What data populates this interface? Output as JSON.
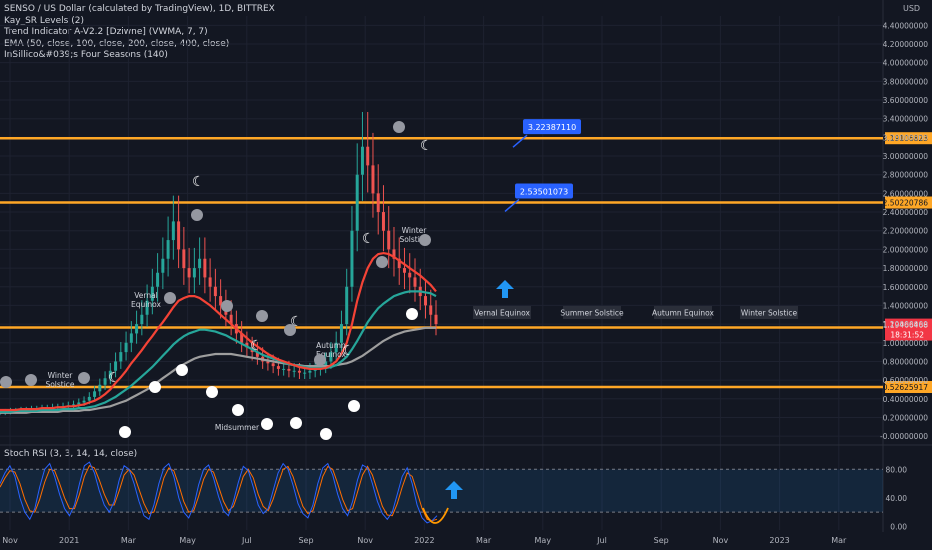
{
  "chart_data": {
    "type": "line",
    "title": "SENSO / US Dollar (calculated by TradingView), 1D, BITTREX",
    "indicators": [
      "Kay_SR Levels (2)",
      "Trend Indicator A-V2.2 [Dziwne] (VWMA, 7, 7)",
      "EMA (50, close, 100, close, 200, close, 400, close)",
      "InSillico&#039;s Four Seasons (140)"
    ],
    "currency": "USD",
    "y_ticks": [
      "4.40000000",
      "4.20000000",
      "4.00000000",
      "3.80000000",
      "3.60000000",
      "3.40000000",
      "3.20000000",
      "3.00000000",
      "2.80000000",
      "2.60000000",
      "2.40000000",
      "2.20000000",
      "2.00000000",
      "1.80000000",
      "1.60000000",
      "1.40000000",
      "1.20000000",
      "1.00000000",
      "0.80000000",
      "0.60000000",
      "0.40000000",
      "0.20000000",
      "-0.00000000"
    ],
    "ylim": [
      -0.02,
      4.5
    ],
    "x_labels": [
      "Nov",
      "2021",
      "Mar",
      "May",
      "Jul",
      "Sep",
      "Nov",
      "2022",
      "Mar",
      "May",
      "Jul",
      "Sep",
      "Nov",
      "2023",
      "Mar"
    ],
    "sr_levels": [
      {
        "value": 3.19106823,
        "label": "3.19106823"
      },
      {
        "value": 2.50220786,
        "label": "2.50220786"
      },
      {
        "value": 1.16385056,
        "label": "1.16385056"
      },
      {
        "value": 0.52625917,
        "label": "0.52625917"
      }
    ],
    "current_price": {
      "value": 1.19466468,
      "label": "1.19466468",
      "countdown": "18:31:52"
    },
    "callouts": [
      {
        "label": "3.22387110",
        "value": 3.2238711
      },
      {
        "label": "2.53501073",
        "value": 2.53501073
      }
    ],
    "season_labels_projected": [
      "Vernal Equinox",
      "Summer Solstice",
      "Autumn Equinox",
      "Winter Solstice"
    ],
    "season_labels_history": [
      "Vernal Equinox",
      "Winter Solstice",
      "Midsummer",
      "Autumn Equinox",
      "Winter Solstice"
    ],
    "price": [
      0.25,
      0.26,
      0.27,
      0.27,
      0.28,
      0.28,
      0.29,
      0.29,
      0.3,
      0.3,
      0.31,
      0.31,
      0.32,
      0.33,
      0.34,
      0.36,
      0.38,
      0.42,
      0.48,
      0.55,
      0.62,
      0.7,
      0.8,
      0.9,
      1.0,
      1.1,
      1.2,
      1.3,
      1.45,
      1.6,
      1.75,
      1.9,
      2.1,
      2.3,
      2.0,
      1.8,
      1.7,
      1.8,
      1.9,
      1.7,
      1.6,
      1.5,
      1.4,
      1.3,
      1.2,
      1.1,
      1.0,
      0.95,
      0.9,
      0.85,
      0.8,
      0.78,
      0.75,
      0.72,
      0.72,
      0.7,
      0.7,
      0.68,
      0.68,
      0.7,
      0.72,
      0.75,
      0.8,
      0.9,
      1.0,
      1.2,
      1.6,
      2.2,
      2.8,
      3.1,
      2.9,
      2.6,
      2.4,
      2.2,
      2.0,
      1.9,
      1.8,
      1.75,
      1.7,
      1.6,
      1.5,
      1.4,
      1.3,
      1.2
    ],
    "ema_fast": [
      0.28,
      0.28,
      0.28,
      0.28,
      0.29,
      0.29,
      0.29,
      0.29,
      0.3,
      0.3,
      0.3,
      0.31,
      0.31,
      0.32,
      0.32,
      0.33,
      0.34,
      0.36,
      0.38,
      0.41,
      0.45,
      0.5,
      0.57,
      0.63,
      0.7,
      0.78,
      0.85,
      0.92,
      1.0,
      1.07,
      1.15,
      1.22,
      1.3,
      1.38,
      1.45,
      1.48,
      1.5,
      1.5,
      1.48,
      1.44,
      1.4,
      1.35,
      1.3,
      1.25,
      1.2,
      1.15,
      1.1,
      1.05,
      1.0,
      0.96,
      0.92,
      0.88,
      0.85,
      0.82,
      0.8,
      0.78,
      0.76,
      0.74,
      0.73,
      0.72,
      0.72,
      0.72,
      0.73,
      0.76,
      0.8,
      0.88,
      1.0,
      1.2,
      1.45,
      1.65,
      1.8,
      1.9,
      1.95,
      1.96,
      1.95,
      1.92,
      1.88,
      1.84,
      1.8,
      1.76,
      1.72,
      1.67,
      1.62,
      1.55
    ],
    "ema_mid": [
      0.26,
      0.26,
      0.26,
      0.27,
      0.27,
      0.27,
      0.27,
      0.27,
      0.28,
      0.28,
      0.28,
      0.28,
      0.29,
      0.29,
      0.29,
      0.3,
      0.3,
      0.31,
      0.32,
      0.34,
      0.36,
      0.39,
      0.42,
      0.46,
      0.5,
      0.54,
      0.59,
      0.64,
      0.69,
      0.74,
      0.8,
      0.86,
      0.92,
      0.98,
      1.03,
      1.07,
      1.1,
      1.12,
      1.14,
      1.14,
      1.13,
      1.12,
      1.1,
      1.08,
      1.05,
      1.02,
      0.99,
      0.96,
      0.93,
      0.9,
      0.87,
      0.85,
      0.83,
      0.81,
      0.79,
      0.77,
      0.76,
      0.75,
      0.74,
      0.73,
      0.73,
      0.73,
      0.73,
      0.74,
      0.76,
      0.8,
      0.85,
      0.93,
      1.02,
      1.12,
      1.22,
      1.3,
      1.37,
      1.42,
      1.46,
      1.5,
      1.52,
      1.54,
      1.55,
      1.55,
      1.55,
      1.54,
      1.53,
      1.5
    ],
    "ema_slow": [
      0.25,
      0.25,
      0.25,
      0.25,
      0.25,
      0.25,
      0.26,
      0.26,
      0.26,
      0.26,
      0.26,
      0.26,
      0.27,
      0.27,
      0.27,
      0.27,
      0.28,
      0.28,
      0.29,
      0.3,
      0.31,
      0.32,
      0.34,
      0.36,
      0.38,
      0.41,
      0.44,
      0.47,
      0.5,
      0.54,
      0.58,
      0.62,
      0.66,
      0.7,
      0.74,
      0.77,
      0.8,
      0.83,
      0.85,
      0.86,
      0.87,
      0.88,
      0.88,
      0.88,
      0.88,
      0.87,
      0.86,
      0.85,
      0.84,
      0.83,
      0.82,
      0.81,
      0.8,
      0.79,
      0.78,
      0.77,
      0.76,
      0.76,
      0.75,
      0.75,
      0.75,
      0.75,
      0.75,
      0.75,
      0.76,
      0.77,
      0.78,
      0.8,
      0.83,
      0.86,
      0.9,
      0.94,
      0.98,
      1.02,
      1.05,
      1.08,
      1.1,
      1.12,
      1.13,
      1.14,
      1.15,
      1.16,
      1.16,
      1.16
    ],
    "rsi": {
      "name": "Stoch RSI (3, 3, 14, 14, close)",
      "ticks": [
        "80.00",
        "40.00",
        "0.00"
      ],
      "ylim": [
        -5,
        100
      ],
      "k": [
        60,
        75,
        85,
        70,
        40,
        20,
        10,
        25,
        55,
        80,
        88,
        70,
        45,
        25,
        15,
        30,
        60,
        85,
        90,
        75,
        50,
        30,
        20,
        35,
        65,
        85,
        80,
        60,
        35,
        15,
        10,
        30,
        60,
        82,
        88,
        70,
        40,
        20,
        12,
        28,
        58,
        80,
        86,
        68,
        42,
        22,
        15,
        35,
        62,
        84,
        78,
        55,
        30,
        18,
        25,
        50,
        75,
        88,
        80,
        58,
        32,
        18,
        12,
        30,
        60,
        82,
        88,
        72,
        45,
        25,
        15,
        35,
        65,
        86,
        82,
        60,
        35,
        18,
        10,
        20,
        45,
        70,
        82,
        60,
        30,
        12,
        5,
        8,
        15
      ],
      "d": [
        55,
        68,
        78,
        76,
        60,
        38,
        22,
        20,
        38,
        62,
        80,
        78,
        60,
        40,
        25,
        25,
        45,
        70,
        85,
        82,
        65,
        45,
        30,
        30,
        50,
        72,
        80,
        72,
        52,
        32,
        18,
        20,
        42,
        68,
        82,
        78,
        58,
        35,
        20,
        22,
        42,
        66,
        80,
        76,
        56,
        35,
        22,
        28,
        48,
        70,
        80,
        68,
        45,
        28,
        22,
        38,
        60,
        80,
        84,
        70,
        48,
        28,
        18,
        22,
        45,
        70,
        84,
        80,
        60,
        38,
        22,
        25,
        48,
        72,
        84,
        72,
        50,
        28,
        16,
        15,
        32,
        55,
        75,
        70,
        48,
        25,
        10,
        8,
        10
      ]
    }
  }
}
